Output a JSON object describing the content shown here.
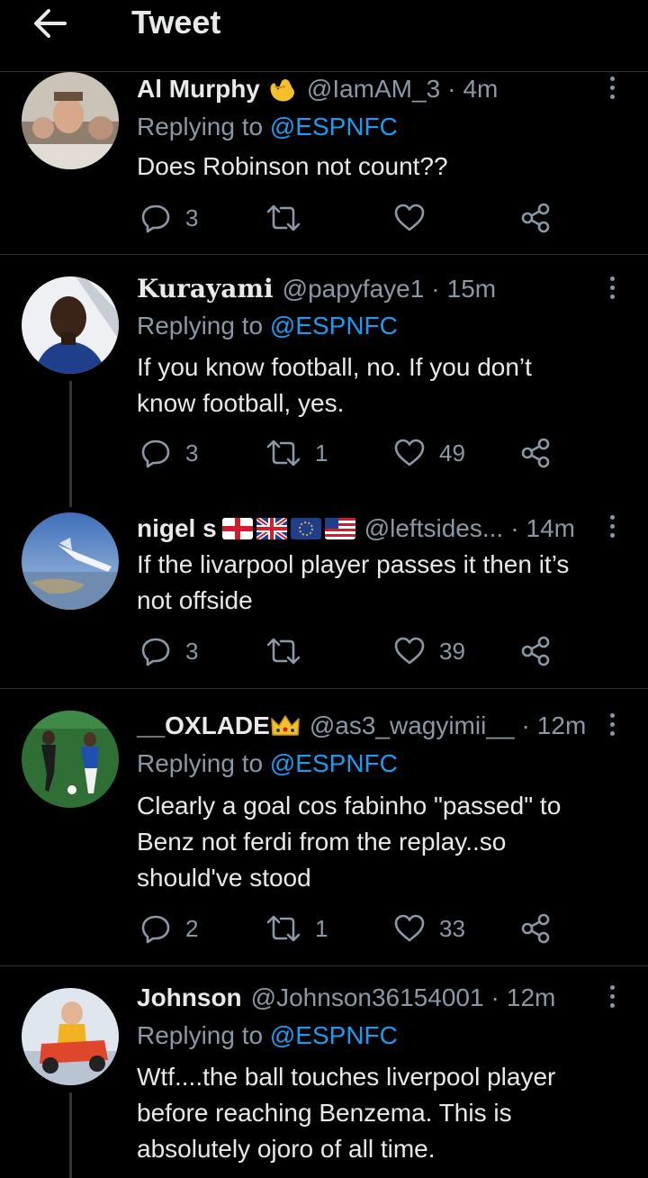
{
  "header": {
    "title": "Tweet"
  },
  "tweets": [
    {
      "name": "Al Murphy",
      "handle": "@IamAM_3",
      "time": "4m",
      "replying_label": "Replying to",
      "replying_to": "@ESPNFC",
      "text": "Does Robinson not count??",
      "replies": "3",
      "retweets": "",
      "likes": ""
    },
    {
      "name": "Kurayami",
      "handle": "@papyfaye1",
      "time": "15m",
      "replying_label": "Replying to",
      "replying_to": "@ESPNFC",
      "text": "If you know football, no. If you don’t\nknow football, yes.",
      "replies": "3",
      "retweets": "1",
      "likes": "49"
    },
    {
      "name": "nigel s",
      "handle": "@leftsides...",
      "time": "14m",
      "text": "If the livarpool player passes it then it’s\nnot offside",
      "replies": "3",
      "retweets": "",
      "likes": "39"
    },
    {
      "name": "__OXLADE",
      "handle": "@as3_wagyimii__",
      "time": "12m",
      "replying_label": "Replying to",
      "replying_to": "@ESPNFC",
      "text": "Clearly a goal cos fabinho \"passed\" to\nBenz not ferdi from the replay..so\nshould've stood",
      "replies": "2",
      "retweets": "1",
      "likes": "33"
    },
    {
      "name": "Johnson",
      "handle": "@Johnson36154001",
      "time": "12m",
      "replying_label": "Replying to",
      "replying_to": "@ESPNFC",
      "text": "Wtf....the ball touches liverpool player\nbefore reaching Benzema. This is\nabsolutely ojoro of all time."
    }
  ],
  "colors": {
    "background": "#000000",
    "text": "#e7e9ea",
    "muted": "#8b98a5",
    "accent": "#1d9bf0",
    "divider": "#2f3336"
  },
  "icons": [
    "back-arrow-icon",
    "reply-icon",
    "retweet-icon",
    "like-icon",
    "share-icon",
    "more-icon"
  ]
}
